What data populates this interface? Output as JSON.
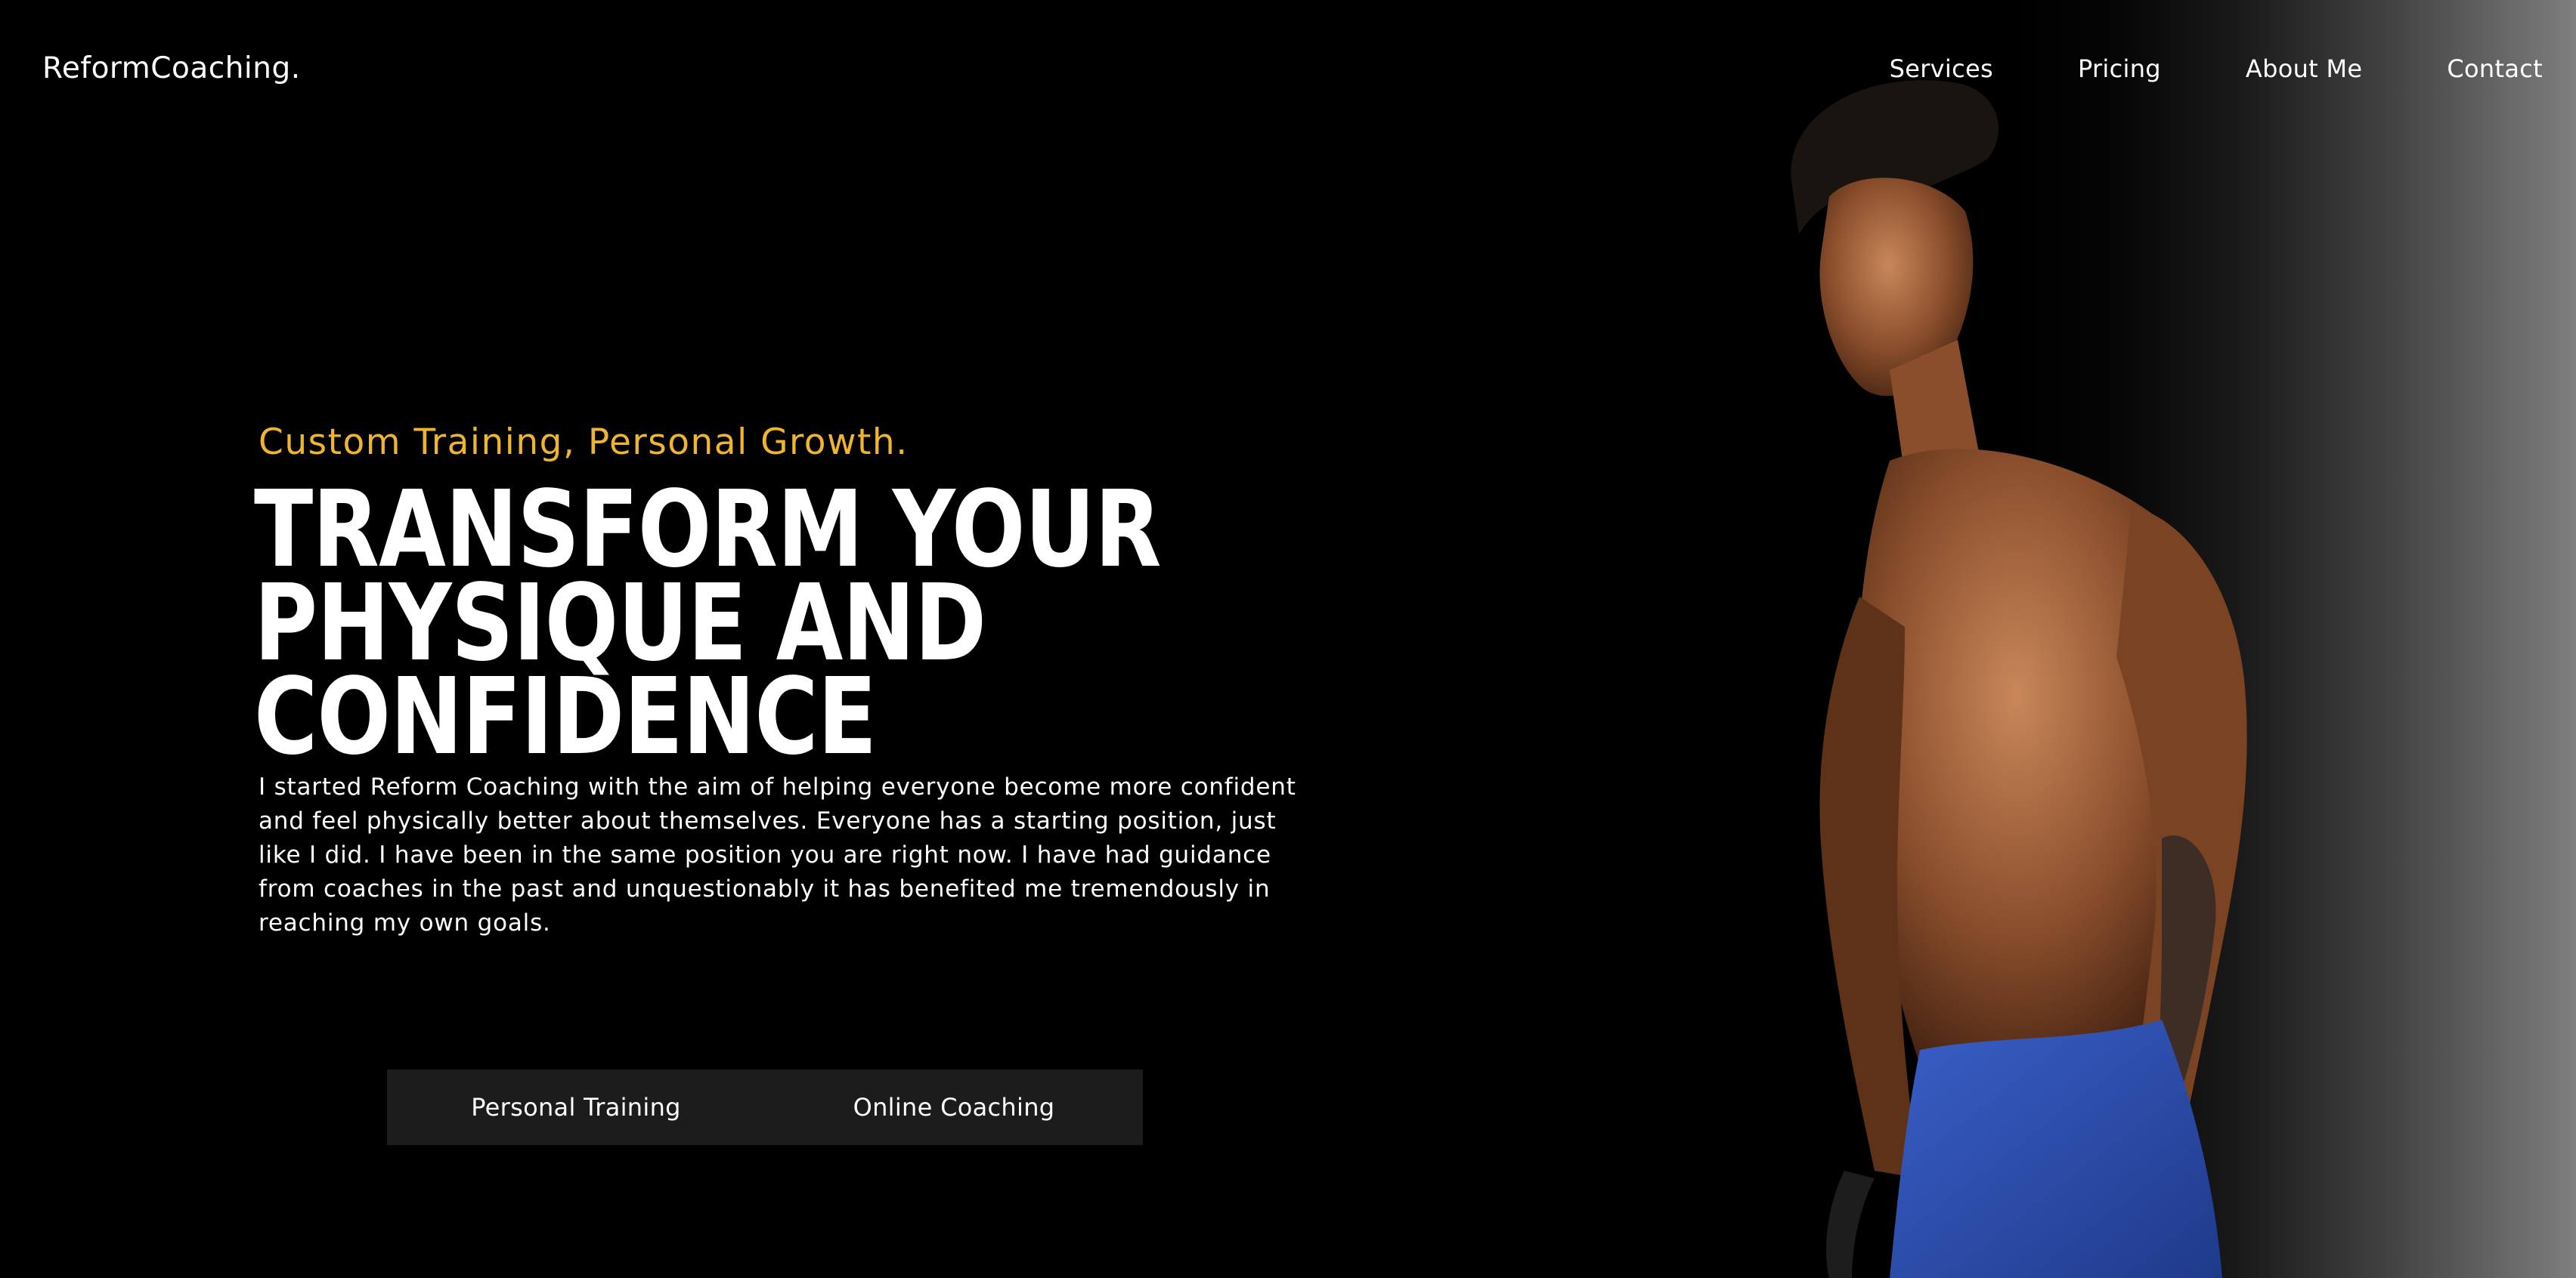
{
  "brand": {
    "logo": "ReformCoaching."
  },
  "nav": {
    "items": [
      {
        "label": "Services"
      },
      {
        "label": "Pricing"
      },
      {
        "label": "About Me"
      },
      {
        "label": "Contact"
      }
    ]
  },
  "hero": {
    "tagline": "Custom Training, Personal Growth.",
    "headline_lines": [
      "TRANSFORM YOUR",
      "PHYSIQUE AND",
      "CONFIDENCE"
    ],
    "intro": "I started Reform Coaching with the aim of helping everyone become more confident and feel physically better about themselves. Everyone has a starting position, just like I did. I have been in the same position you are right now. I have had guidance from coaches in the past and unquestionably it has benefited me tremendously in reaching my own goals.",
    "tabs": [
      {
        "label": "Personal Training"
      },
      {
        "label": "Online Coaching"
      }
    ]
  },
  "colors": {
    "accent": "#f0b52e",
    "background": "#000000",
    "tab_bar": "#1c1c1c",
    "shorts": "#3a5fc8"
  },
  "images": {
    "hero_photo": "muscular-man-with-battle-rope"
  }
}
